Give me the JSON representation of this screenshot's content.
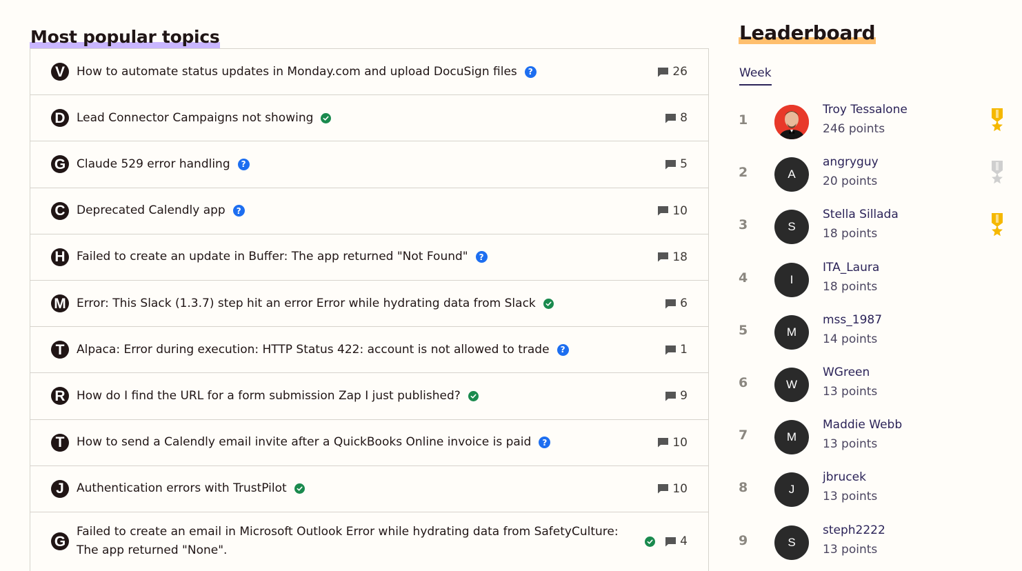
{
  "topics": {
    "title": "Most popular topics",
    "items": [
      {
        "letter": "V",
        "title": "How to automate status updates in Monday.com and upload DocuSign files",
        "status": "question",
        "replies": "26"
      },
      {
        "letter": "D",
        "title": "Lead Connector Campaigns not showing",
        "status": "solved",
        "replies": "8"
      },
      {
        "letter": "G",
        "title": "Claude 529 error handling",
        "status": "question",
        "replies": "5"
      },
      {
        "letter": "C",
        "title": "Deprecated Calendly app",
        "status": "question",
        "replies": "10"
      },
      {
        "letter": "H",
        "title": "Failed to create an update in Buffer: The app returned \"Not Found\"",
        "status": "question",
        "replies": "18"
      },
      {
        "letter": "M",
        "title": "Error: This Slack (1.3.7) step hit an error Error while hydrating data from Slack",
        "status": "solved",
        "replies": "6"
      },
      {
        "letter": "T",
        "title": "Alpaca: Error during execution: HTTP Status 422: account is not allowed to trade",
        "status": "question",
        "replies": "1"
      },
      {
        "letter": "R",
        "title": "How do I find the URL for a form submission Zap I just published?",
        "status": "solved",
        "replies": "9"
      },
      {
        "letter": "T",
        "title": "How to send a Calendly email invite after a QuickBooks Online invoice is paid",
        "status": "question",
        "replies": "10"
      },
      {
        "letter": "J",
        "title": "Authentication errors with TrustPilot",
        "status": "solved",
        "replies": "10"
      },
      {
        "letter": "G",
        "title": "Failed to create an email in Microsoft Outlook Error while hydrating data from SafetyCulture: The app returned \"None\".",
        "status": "solved",
        "replies": "4"
      }
    ]
  },
  "leaderboard": {
    "title": "Leaderboard",
    "tab": "Week",
    "entries": [
      {
        "rank": "1",
        "initial": "",
        "name": "Troy Tessalone",
        "points": "246 points",
        "medal": "gold"
      },
      {
        "rank": "2",
        "initial": "A",
        "name": "angryguy",
        "points": "20 points",
        "medal": "silver"
      },
      {
        "rank": "3",
        "initial": "S",
        "name": "Stella Sillada",
        "points": "18 points",
        "medal": "gold"
      },
      {
        "rank": "4",
        "initial": "I",
        "name": "ITA_Laura",
        "points": "18 points",
        "medal": ""
      },
      {
        "rank": "5",
        "initial": "M",
        "name": "mss_1987",
        "points": "14 points",
        "medal": ""
      },
      {
        "rank": "6",
        "initial": "W",
        "name": "WGreen",
        "points": "13 points",
        "medal": ""
      },
      {
        "rank": "7",
        "initial": "M",
        "name": "Maddie Webb",
        "points": "13 points",
        "medal": ""
      },
      {
        "rank": "8",
        "initial": "J",
        "name": "jbrucek",
        "points": "13 points",
        "medal": ""
      },
      {
        "rank": "9",
        "initial": "S",
        "name": "steph2222",
        "points": "13 points",
        "medal": ""
      }
    ]
  },
  "colors": {
    "question": "#1d6ef0",
    "solved": "#1a8a4e",
    "gold": "#f5b800",
    "silver": "#cfcfcf",
    "topics_underline": "#c9b6ff",
    "leaderboard_underline": "#ffbf6e"
  }
}
